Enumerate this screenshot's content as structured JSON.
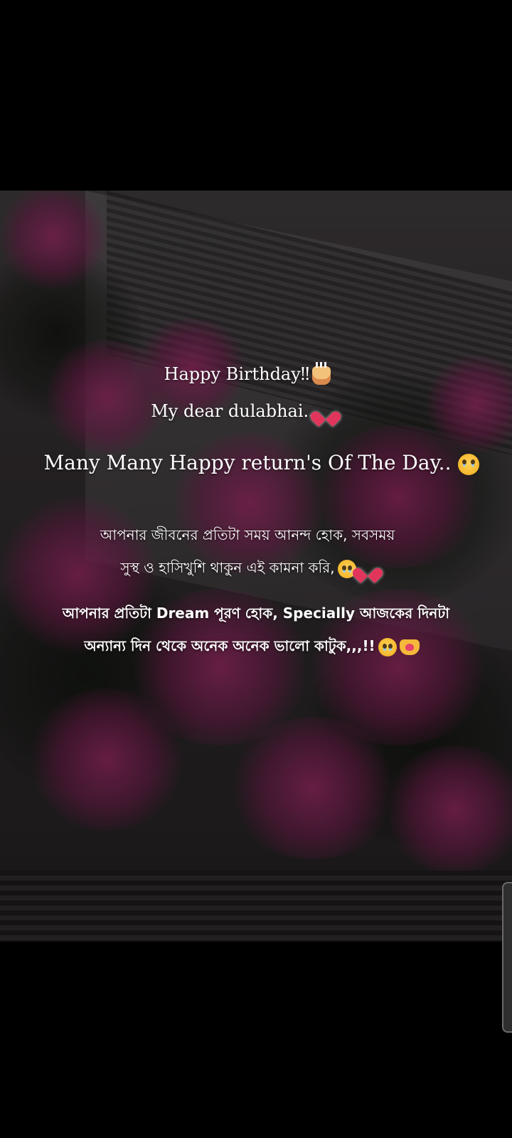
{
  "status": {
    "greeting_line_1": "Happy Birthday‼",
    "greeting_line_2": "My dear dulabhai..",
    "greeting_line_3": "Many Many Happy return's Of The Day..",
    "wish_line_1": "আপনার জীবনের প্রতিটা সময় আনন্দ হোক, সবসময়",
    "wish_line_2": "সুস্থ ও হাসিখুশি থাকুন এই কামনা করি,",
    "wish_line_3": "আপনার প্রতিটা  Dream পূরণ হোক, Specially আজকের দিনটা",
    "wish_line_4": "অন্যান্য দিন থেকে অনেক অনেক ভালো কাটুক,,,!!"
  },
  "icons": {
    "cake": "birthday-cake-icon",
    "heart": "glowing-heart-icon",
    "tear": "holding-back-tears-icon",
    "hands": "heart-hands-icon"
  },
  "colors": {
    "background": "#000000",
    "text": "#ffffff",
    "blossom": "#b93278"
  }
}
